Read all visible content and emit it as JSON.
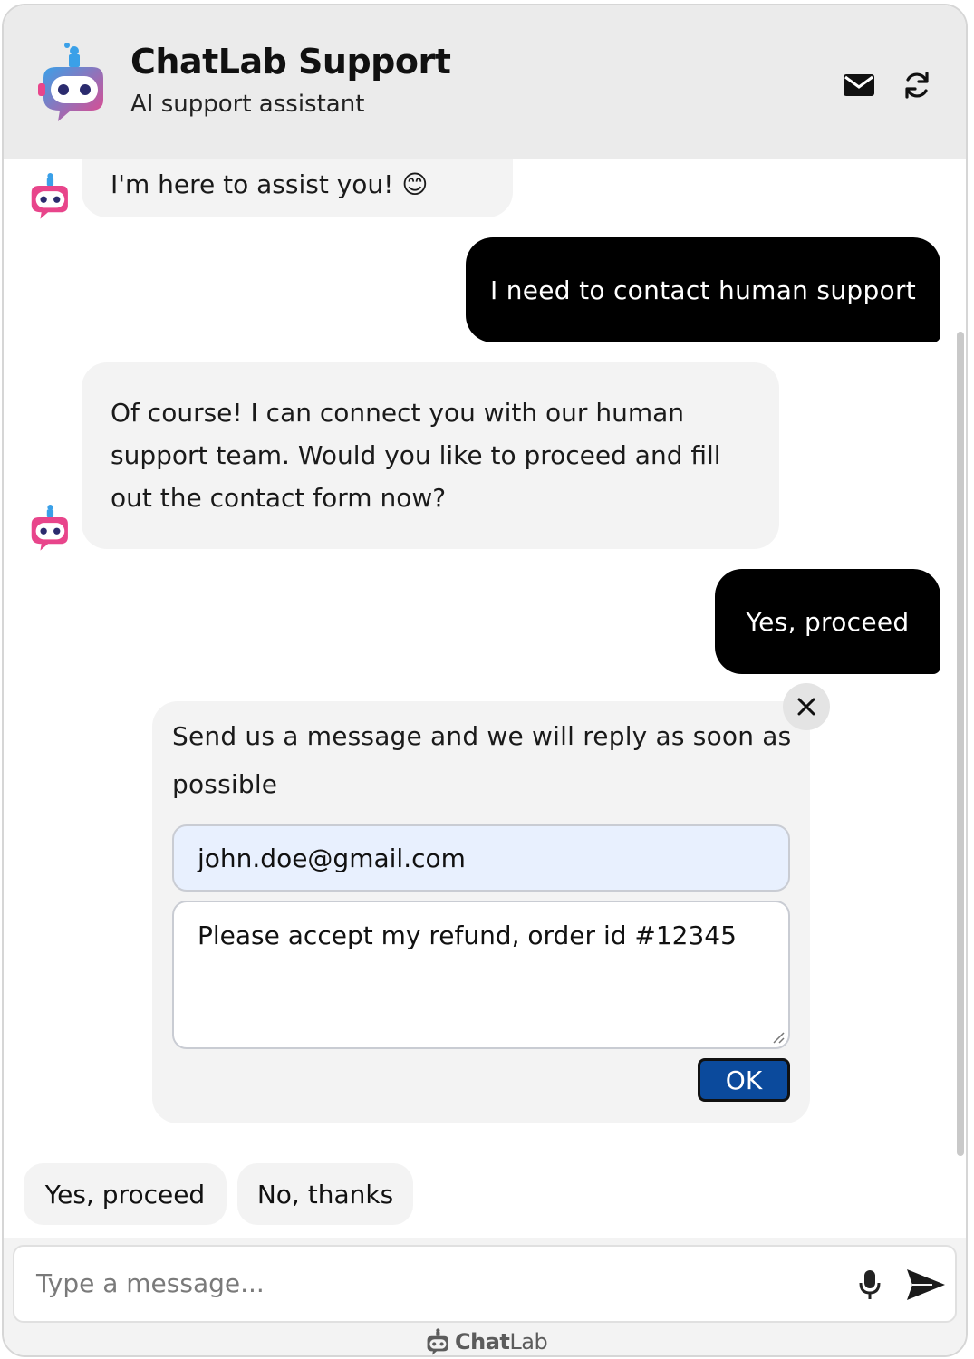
{
  "header": {
    "title": "ChatLab Support",
    "subtitle": "AI support assistant",
    "icons": [
      "robot-logo-icon",
      "mail-icon",
      "refresh-icon"
    ]
  },
  "messages": [
    {
      "role": "bot",
      "text": "I'm here to assist you! 😊"
    },
    {
      "role": "user",
      "text": "I need to contact human support"
    },
    {
      "role": "bot",
      "text": "Of course! I can connect you with our human support team. Would you like to proceed and fill out the contact form now?"
    },
    {
      "role": "user",
      "text": "Yes, proceed"
    }
  ],
  "contact_form": {
    "intro": "Send us a message and we will reply as soon as possible",
    "email_value": "john.doe@gmail.com",
    "message_value": "Please accept my refund, order id #12345",
    "submit_label": "OK"
  },
  "quick_replies": [
    "Yes, proceed",
    "No, thanks"
  ],
  "composer": {
    "placeholder": "Type a message...",
    "icons": [
      "microphone-icon",
      "send-icon"
    ]
  },
  "branding": {
    "name_bold": "Chat",
    "name_light": "Lab"
  },
  "colors": {
    "header_bg": "#ebebeb",
    "user_bubble": "#000000",
    "bot_bubble": "#f3f3f3",
    "ok_button": "#0b4a9c",
    "logo_pink": "#e8458b",
    "logo_blue": "#3aa0e8",
    "email_field_bg": "#e8f0fe"
  }
}
